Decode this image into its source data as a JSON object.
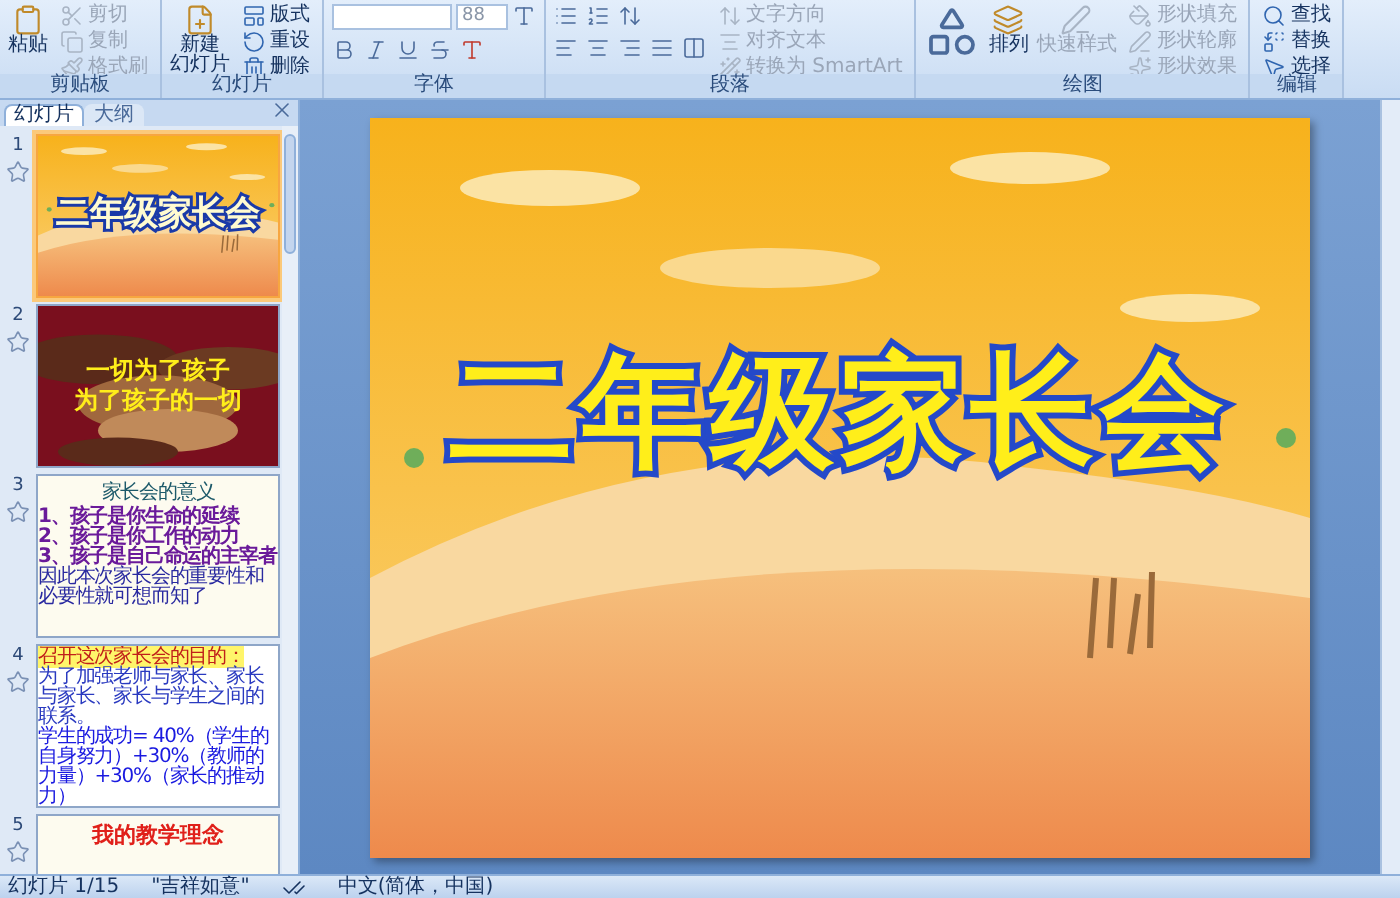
{
  "ribbon": {
    "clipboard": {
      "label": "剪贴板",
      "paste": "粘贴",
      "items": [
        {
          "label": "剪切",
          "disabled": true
        },
        {
          "label": "复制",
          "disabled": true
        },
        {
          "label": "格式刷",
          "disabled": true
        }
      ]
    },
    "slides": {
      "label": "幻灯片",
      "new_slide": [
        "新建",
        "幻灯片"
      ],
      "items": [
        {
          "label": "版式",
          "disabled": false
        },
        {
          "label": "重设",
          "disabled": false
        },
        {
          "label": "删除",
          "disabled": false
        }
      ]
    },
    "font": {
      "label": "字体",
      "size": "88"
    },
    "paragraph": {
      "label": "段落",
      "items": [
        {
          "label": "文字方向",
          "disabled": true
        },
        {
          "label": "对齐文本",
          "disabled": true
        },
        {
          "label": "转换为 SmartArt",
          "disabled": true
        }
      ]
    },
    "drawing": {
      "label": "绘图",
      "arrange": "排列",
      "quick_styles": "快速样式",
      "items": [
        {
          "label": "形状填充",
          "disabled": true
        },
        {
          "label": "形状轮廓",
          "disabled": true
        },
        {
          "label": "形状效果",
          "disabled": true
        }
      ]
    },
    "editing": {
      "label": "编辑",
      "items": [
        {
          "label": "查找",
          "disabled": false
        },
        {
          "label": "替换",
          "disabled": false
        },
        {
          "label": "选择",
          "disabled": false
        }
      ]
    }
  },
  "panel": {
    "tabs": [
      {
        "label": "幻灯片",
        "selected": true
      },
      {
        "label": "大纲",
        "selected": false
      }
    ]
  },
  "slides": [
    {
      "number": "1",
      "selected": true,
      "kind": "title",
      "title": "二年级家长会"
    },
    {
      "number": "2",
      "selected": false,
      "lines": [
        "一切为了孩子",
        "为了孩子的一切"
      ]
    },
    {
      "number": "3",
      "selected": false,
      "kind": "bullets",
      "title": "家长会的意义",
      "lines": [
        "1、孩子是你生命的延续",
        "2、孩子是你工作的动力",
        "3、孩子是自己命运的主宰者"
      ],
      "note": "因此本次家长会的重要性和必要性就可想而知了"
    },
    {
      "number": "4",
      "selected": false,
      "kind": "goal",
      "title": "召开这次家长会的目的：",
      "note": "为了加强老师与家长、家长与家长、家长与学生之间的联系。",
      "body": "学生的成功= 40%（学生的自身努力）+30%（教师的力量）+30%（家长的推动力）"
    },
    {
      "number": "5",
      "selected": false,
      "kind": "heading",
      "title": "我的教学理念"
    }
  ],
  "main_slide": {
    "title": "二年级家长会"
  },
  "status_bar": {
    "slide": "幻灯片 1/15",
    "theme": "\"吉祥如意\"",
    "language": "中文(简体，中国)"
  }
}
